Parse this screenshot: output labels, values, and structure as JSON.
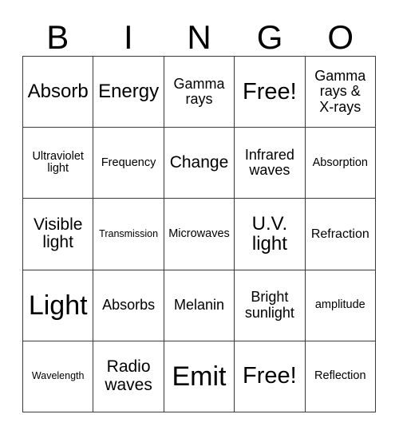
{
  "card": {
    "title": "BINGO Card",
    "header_letters": [
      "B",
      "I",
      "N",
      "G",
      "O"
    ],
    "colors": {
      "background": "#ffffff",
      "text": "#000000",
      "grid_line": "#3a3a3a"
    },
    "grid": {
      "columns": 5,
      "rows": 5,
      "cells": [
        {
          "text": "Absorb",
          "size": "xl"
        },
        {
          "text": "Energy",
          "size": "xl"
        },
        {
          "text": "Gamma\nrays",
          "size": "m"
        },
        {
          "text": "Free!",
          "size": "xxl"
        },
        {
          "text": "Gamma\nrays &\nX-rays",
          "size": "m"
        },
        {
          "text": "Ultraviolet\nlight",
          "size": "xs"
        },
        {
          "text": "Frequency",
          "size": "xs"
        },
        {
          "text": "Change",
          "size": "l"
        },
        {
          "text": "Infrared\nwaves",
          "size": "m"
        },
        {
          "text": "Absorption",
          "size": "xs"
        },
        {
          "text": "Visible\nlight",
          "size": "l"
        },
        {
          "text": "Transmission",
          "size": "xxs"
        },
        {
          "text": "Microwaves",
          "size": "xs"
        },
        {
          "text": "U.V.\nlight",
          "size": "xl"
        },
        {
          "text": "Refraction",
          "size": "s"
        },
        {
          "text": "Light",
          "size": "max"
        },
        {
          "text": "Absorbs",
          "size": "m"
        },
        {
          "text": "Melanin",
          "size": "m"
        },
        {
          "text": "Bright\nsunlight",
          "size": "m"
        },
        {
          "text": "amplitude",
          "size": "xs"
        },
        {
          "text": "Wavelength",
          "size": "xxs"
        },
        {
          "text": "Radio\nwaves",
          "size": "l"
        },
        {
          "text": "Emit",
          "size": "max"
        },
        {
          "text": "Free!",
          "size": "xxl"
        },
        {
          "text": "Reflection",
          "size": "xs"
        }
      ]
    }
  }
}
